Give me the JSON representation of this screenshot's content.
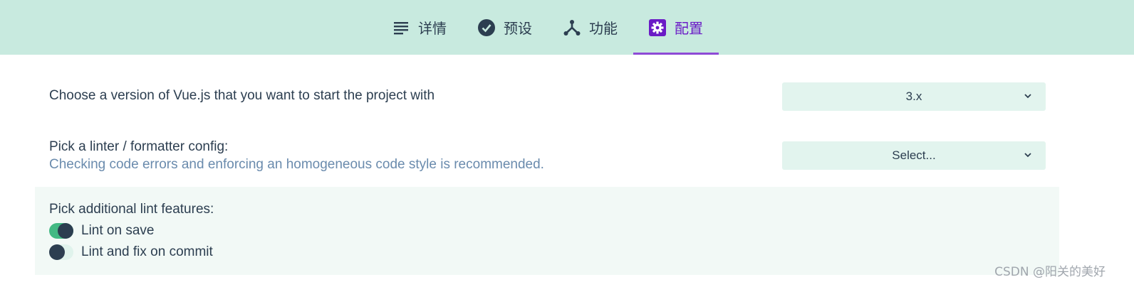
{
  "tabs": [
    {
      "label": "详情",
      "icon": "list-icon"
    },
    {
      "label": "预设",
      "icon": "check-circle-icon"
    },
    {
      "label": "功能",
      "icon": "fork-icon"
    },
    {
      "label": "配置",
      "icon": "gear-icon",
      "active": true
    }
  ],
  "vue_version": {
    "label": "Choose a version of Vue.js that you want to start the project with",
    "selected": "3.x"
  },
  "linter": {
    "label": "Pick a linter / formatter config:",
    "description": "Checking code errors and enforcing an homogeneous code style is recommended.",
    "selected": "Select..."
  },
  "lint_features": {
    "title": "Pick additional lint features:",
    "options": [
      {
        "label": "Lint on save",
        "enabled": true
      },
      {
        "label": "Lint and fix on commit",
        "enabled": false
      }
    ]
  },
  "watermark": "CSDN @阳关的美好",
  "colors": {
    "header_bg": "#c8eadf",
    "accent": "#6a1bc6",
    "toggle_on": "#42b983",
    "text": "#2c3e50",
    "description": "#6a8bad"
  }
}
